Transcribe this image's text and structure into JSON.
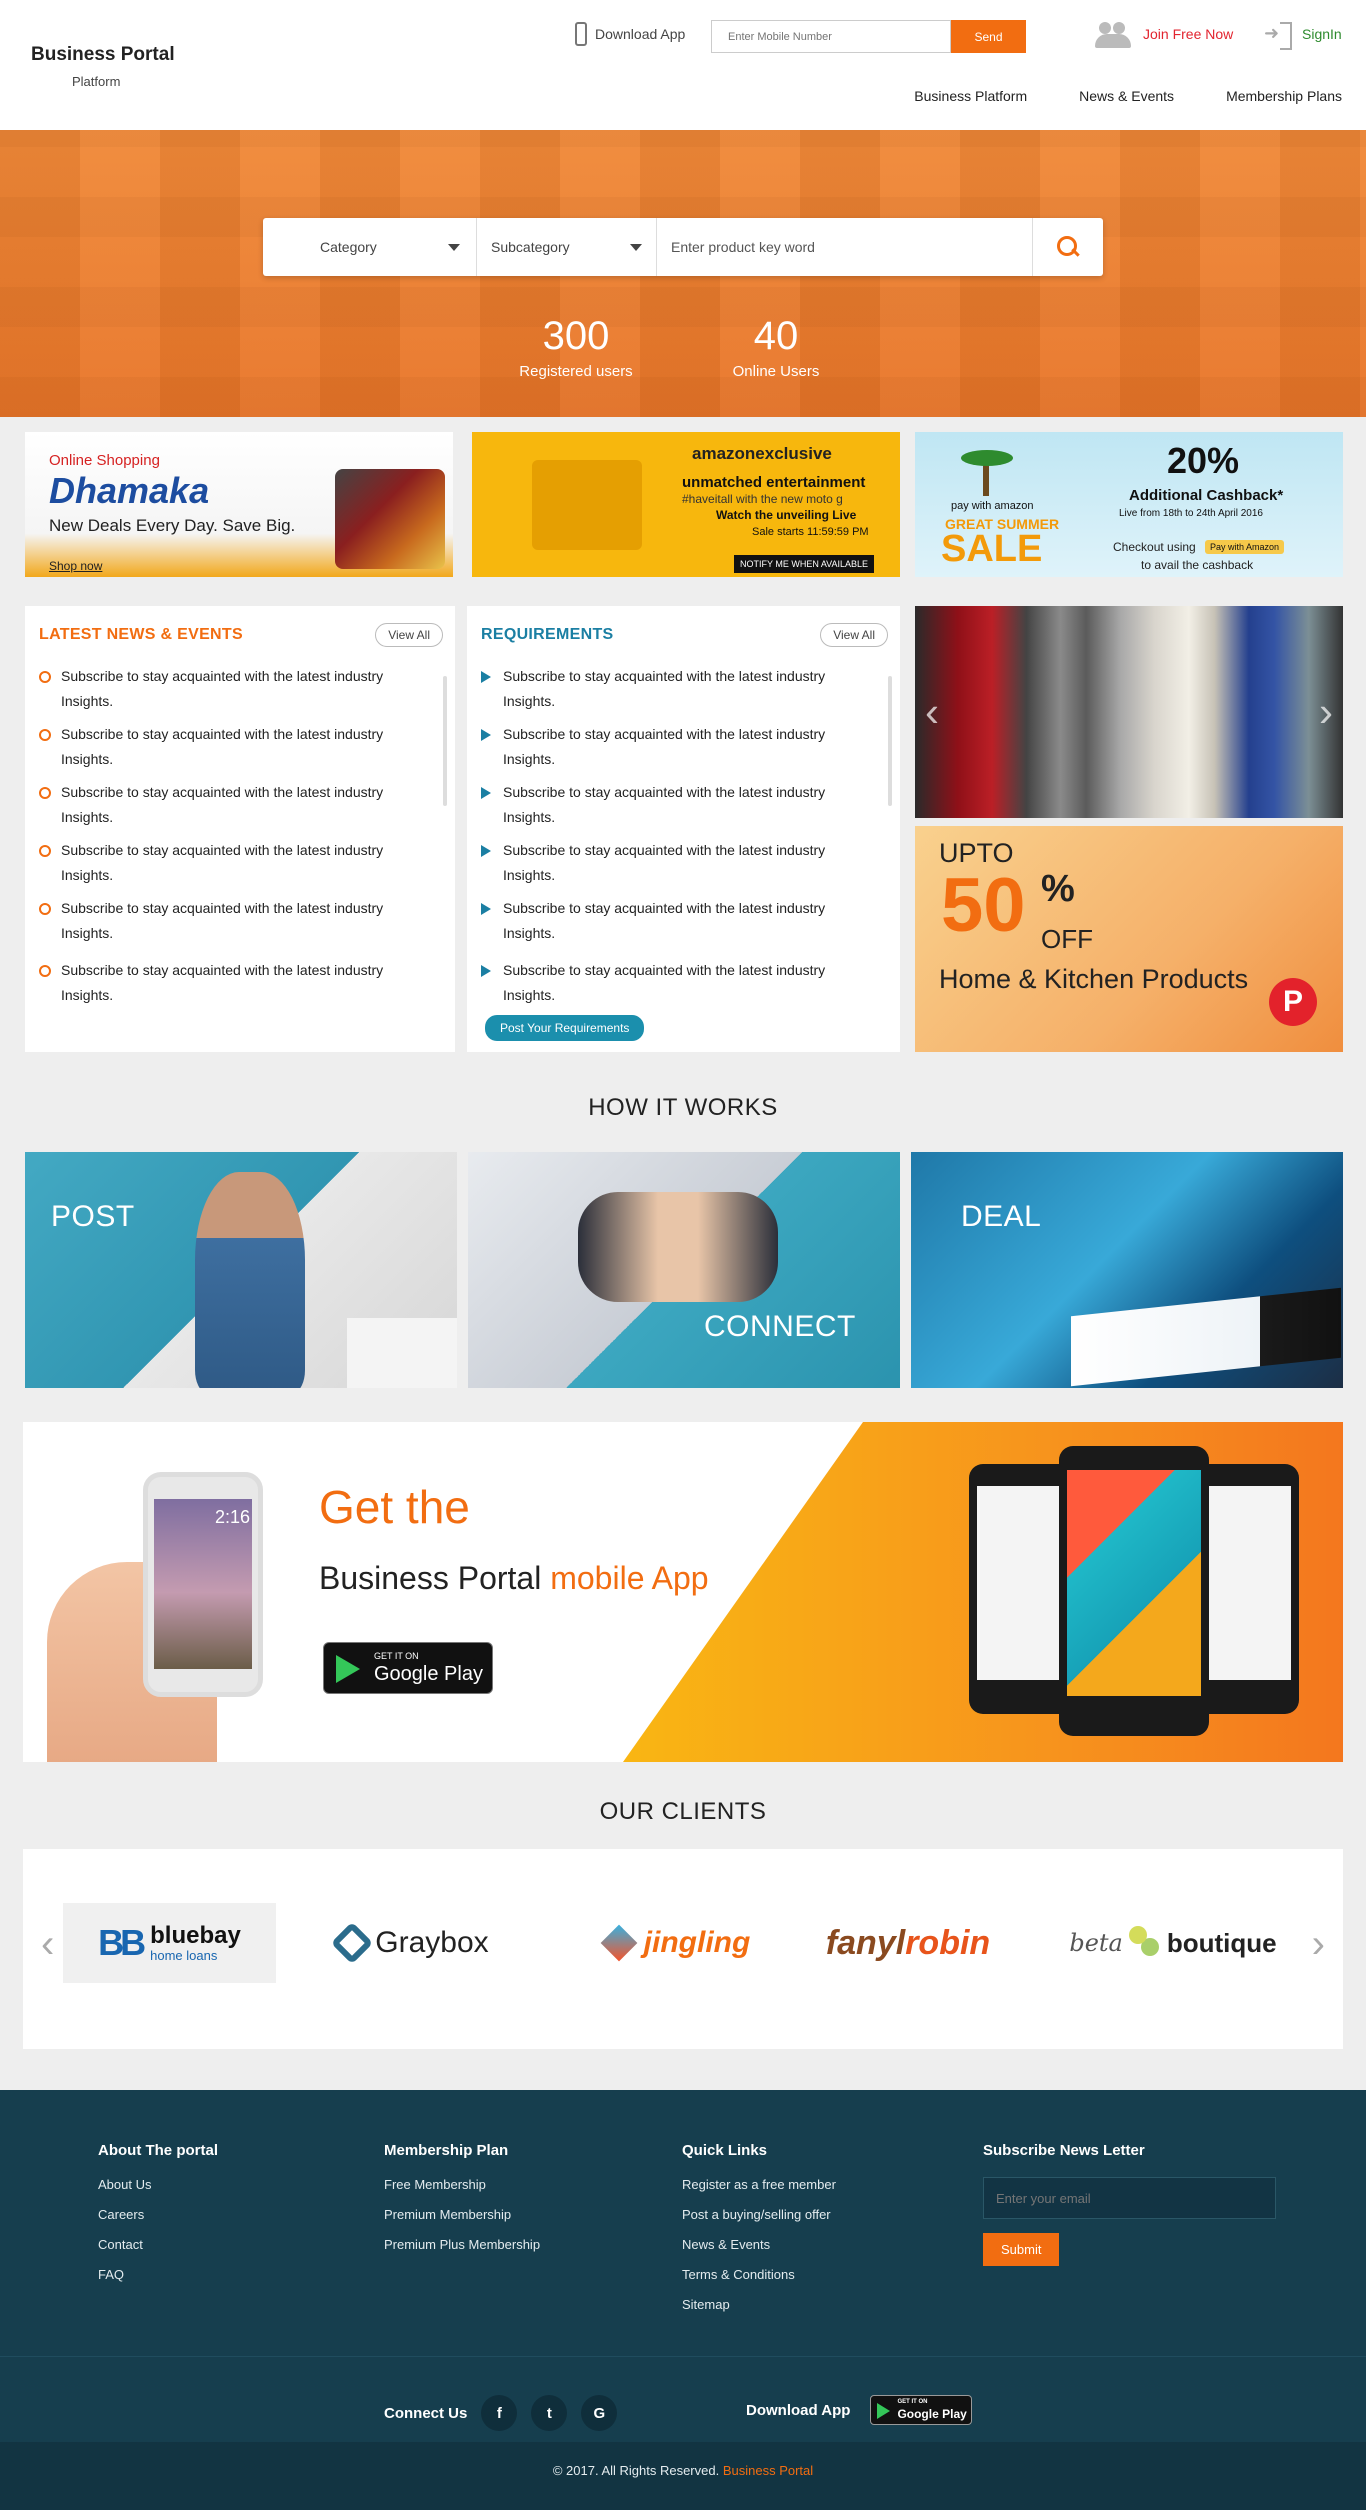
{
  "header": {
    "brand": "Business Portal",
    "brand_sub": "Platform",
    "download_app": "Download App",
    "mobile_placeholder": "Enter Mobile Number",
    "send": "Send",
    "join": "Join Free Now",
    "signin": "SignIn",
    "nav": [
      "Business Platform",
      "News & Events",
      "Membership Plans"
    ]
  },
  "hero": {
    "category": "Category",
    "subcategory": "Subcategory",
    "keyword_placeholder": "Enter product key word",
    "stats": [
      {
        "value": "300",
        "label": "Registered users"
      },
      {
        "value": "40",
        "label": "Online Users"
      }
    ]
  },
  "promos": {
    "p1": {
      "online_shopping": "Online Shopping",
      "dhamaka": "Dhamaka",
      "tagline": "New Deals Every Day. Save Big.",
      "shop_now": "Shop now"
    },
    "p2": {
      "amazon": "amazonexclusive",
      "headline": "unmatched entertainment",
      "hashtag": "#haveitall with the new moto g",
      "watch": "Watch the unveiling Live",
      "sale": "Sale starts 11:59:59 PM",
      "notify": "NOTIFY ME WHEN AVAILABLE"
    },
    "p3": {
      "pay": "pay with amazon",
      "great": "GREAT SUMMER",
      "sale": "SALE",
      "percent": "20%",
      "cashback": "Additional Cashback*",
      "dates": "Live from 18th to 24th April 2016",
      "checkout": "Checkout using",
      "pwa": "Pay with Amazon",
      "avail": "to avail the cashback"
    }
  },
  "news": {
    "title": "LATEST NEWS & EVENTS",
    "view_all": "View All",
    "items": [
      "Subscribe to stay acquainted with the latest industry Insights.",
      "Subscribe to stay acquainted with the latest industry Insights.",
      "Subscribe to stay acquainted with the latest industry Insights.",
      "Subscribe to stay acquainted with the latest industry Insights.",
      "Subscribe to stay acquainted with the latest industry Insights.",
      "Subscribe to stay acquainted with the latest industry Insights."
    ]
  },
  "requirements": {
    "title": "REQUIREMENTS",
    "view_all": "View All",
    "items": [
      "Subscribe to stay acquainted with the latest industry Insights.",
      "Subscribe to stay acquainted with the latest industry Insights.",
      "Subscribe to stay acquainted with the latest industry Insights.",
      "Subscribe to stay acquainted with the latest industry Insights.",
      "Subscribe to stay acquainted with the latest industry Insights.",
      "Subscribe to stay acquainted with the latest industry Insights."
    ],
    "post_button": "Post Your Requirements"
  },
  "kitchen_ad": {
    "upto": "UPTO",
    "fifty": "50",
    "percent": "%",
    "off": "OFF",
    "title": "Home & Kitchen Products",
    "badge": "P"
  },
  "how_it_works": {
    "title": "HOW IT WORKS",
    "steps": [
      "POST",
      "CONNECT",
      "DEAL"
    ]
  },
  "app_banner": {
    "get_the": "Get the",
    "brand": "Business Portal",
    "mobile_app": "mobile App",
    "clock": "2:16",
    "play_small": "GET IT ON",
    "play_big": "Google Play"
  },
  "clients": {
    "title": "OUR CLIENTS",
    "bluebay": {
      "mark": "BB",
      "name": "bluebay",
      "sub": "home loans"
    },
    "graybox": "Graybox",
    "jingling": "jingling",
    "fanylrobin_a": "fanyl",
    "fanylrobin_b": "robin",
    "beta": "beta",
    "boutique": "boutique"
  },
  "footer": {
    "about": {
      "title": "About The portal",
      "links": [
        "About Us",
        "Careers",
        "Contact",
        "FAQ"
      ]
    },
    "membership": {
      "title": "Membership Plan",
      "links": [
        "Free Membership",
        "Premium Membership",
        "Premium Plus Membership"
      ]
    },
    "quick": {
      "title": "Quick Links",
      "links": [
        "Register as a free member",
        "Post a buying/selling offer",
        "News & Events",
        "Terms & Conditions",
        "Sitemap"
      ]
    },
    "newsletter": {
      "title": "Subscribe News Letter",
      "email_placeholder": "Enter your email",
      "submit": "Submit"
    },
    "connect": "Connect Us",
    "social": [
      "f",
      "t",
      "G"
    ],
    "download": "Download App",
    "play_small": "GET IT ON",
    "play_big": "Google Play",
    "copyright": "© 2017. All Rights Reserved.",
    "copyright_brand": "Business Portal"
  },
  "colors": {
    "accent": "#f26d11",
    "teal": "#1b7fa3",
    "footer": "#163e4e"
  }
}
